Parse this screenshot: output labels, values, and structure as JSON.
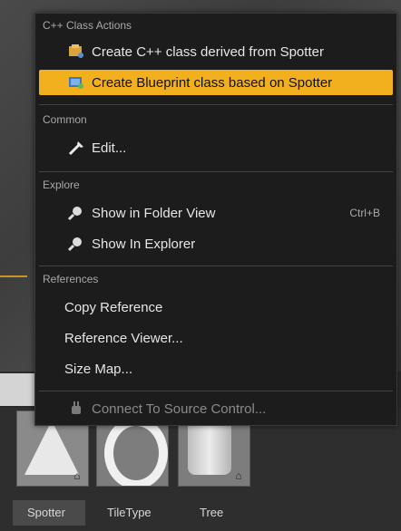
{
  "menu": {
    "sections": [
      {
        "header": "C++ Class Actions",
        "items": [
          {
            "label": "Create C++ class derived from Spotter",
            "icon": "cpp-class-icon"
          },
          {
            "label": "Create Blueprint class based on Spotter",
            "icon": "blueprint-class-icon",
            "highlighted": true
          }
        ]
      },
      {
        "header": "Common",
        "items": [
          {
            "label": "Edit...",
            "icon": "edit-icon"
          }
        ]
      },
      {
        "header": "Explore",
        "items": [
          {
            "label": "Show in Folder View",
            "icon": "magnifier-icon",
            "shortcut": "Ctrl+B"
          },
          {
            "label": "Show In Explorer",
            "icon": "magnifier-icon"
          }
        ]
      },
      {
        "header": "References",
        "items": [
          {
            "label": "Copy Reference"
          },
          {
            "label": "Reference Viewer..."
          },
          {
            "label": "Size Map..."
          }
        ]
      },
      {
        "items": [
          {
            "label": "Connect To Source Control...",
            "icon": "plug-icon",
            "disabled": true
          }
        ]
      }
    ]
  },
  "assets": [
    {
      "name": "Spotter",
      "selected": true,
      "thumbnail": "cone"
    },
    {
      "name": "TileType",
      "thumbnail": "torus"
    },
    {
      "name": "Tree",
      "thumbnail": "cylinder"
    }
  ],
  "colors": {
    "highlight": "#f2b01e",
    "menu_bg": "#1c1c1c"
  }
}
